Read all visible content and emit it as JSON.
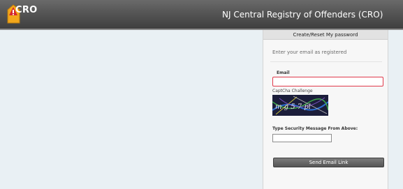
{
  "header": {
    "logo_text": "CRO",
    "title": "NJ Central Registry of Offenders (CRO)"
  },
  "panel": {
    "heading": "Create/Reset My password",
    "intro": "Enter your email as registered",
    "email_label": "Email",
    "email_value": "",
    "captcha_label": "CaptCha Challenge",
    "captcha_text": "m g 5 7 pl",
    "security_label": "Type Security Message From Above:",
    "security_value": "",
    "send_button": "Send Email Link"
  },
  "colors": {
    "header_bg": "#555555",
    "page_bg": "#e9f0f4",
    "logo_orange": "#f2a71b",
    "logo_red": "#d6272b",
    "email_border": "#e0394a",
    "button_bg": "#666666"
  }
}
